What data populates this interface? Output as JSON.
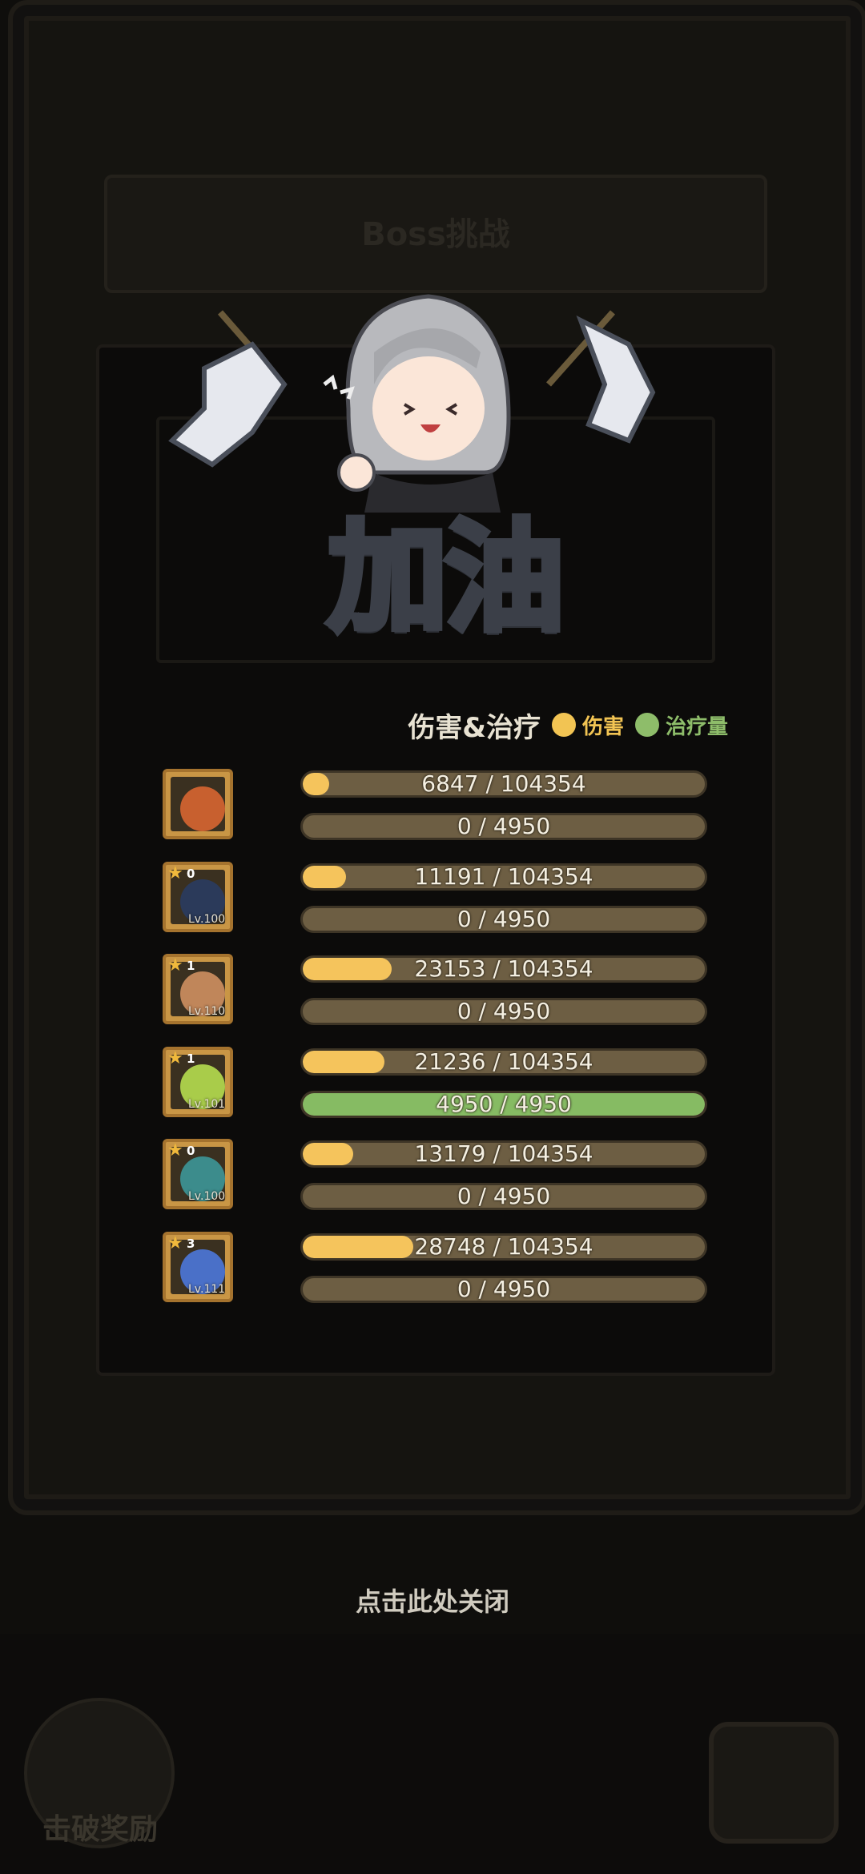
{
  "background": {
    "title": "Boss挑战",
    "reward_label": "击破奖励"
  },
  "cheer": {
    "text": "加油"
  },
  "stats": {
    "title": "伤害&治疗",
    "legend_damage": "伤害",
    "legend_heal": "治疗量",
    "colors": {
      "damage": "#f5c45c",
      "heal": "#86bb63",
      "track": "#6d5e43"
    },
    "heroes": [
      {
        "stars": "",
        "level": "",
        "face": "#c8602f",
        "damage": "6847 / 104354",
        "damage_fraction": 0.066,
        "heal": "0 / 4950",
        "heal_fraction": 0
      },
      {
        "stars": "0",
        "level": "Lv.100",
        "face": "#2b3a5a",
        "damage": "11191 / 104354",
        "damage_fraction": 0.107,
        "heal": "0 / 4950",
        "heal_fraction": 0
      },
      {
        "stars": "1",
        "level": "Lv.110",
        "face": "#c0865a",
        "damage": "23153 / 104354",
        "damage_fraction": 0.222,
        "heal": "0 / 4950",
        "heal_fraction": 0
      },
      {
        "stars": "1",
        "level": "Lv.101",
        "face": "#a9cc4a",
        "damage": "21236 / 104354",
        "damage_fraction": 0.204,
        "heal": "4950 / 4950",
        "heal_fraction": 1
      },
      {
        "stars": "0",
        "level": "Lv.100",
        "face": "#3c8c8c",
        "damage": "13179 / 104354",
        "damage_fraction": 0.126,
        "heal": "0 / 4950",
        "heal_fraction": 0
      },
      {
        "stars": "3",
        "level": "Lv.111",
        "face": "#4a70c8",
        "damage": "28748 / 104354",
        "damage_fraction": 0.275,
        "heal": "0 / 4950",
        "heal_fraction": 0
      }
    ]
  },
  "close_hint": "点击此处关闭"
}
